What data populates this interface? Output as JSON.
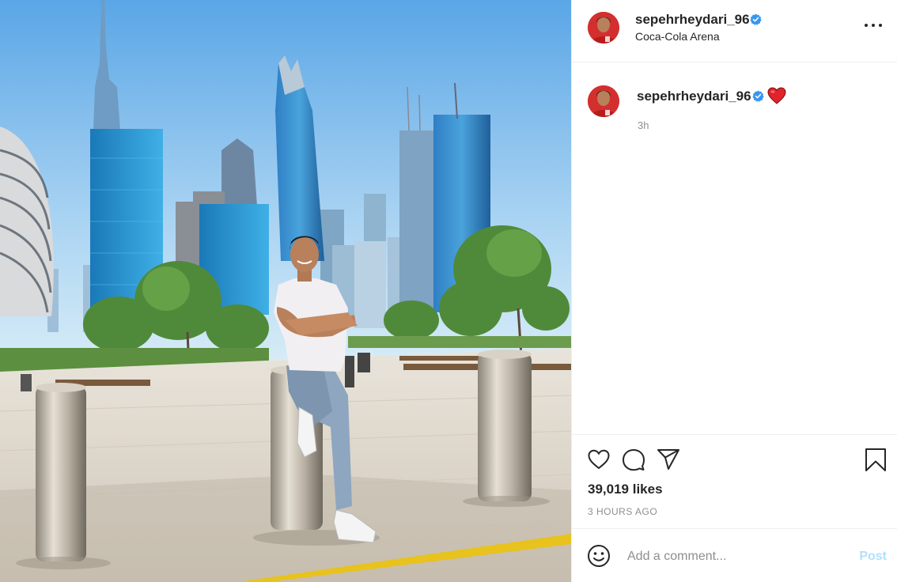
{
  "post": {
    "image_alt": "Man leaning on a bollard in front of Dubai skyscrapers",
    "colors": {
      "accent": "#0095f6",
      "verified": "#3897f0",
      "heart": "#ed4956"
    }
  },
  "header": {
    "username": "sepehrheydari_96",
    "location": "Coca-Cola Arena",
    "verified_icon": "verified-badge-icon",
    "more_icon": "more-options-icon"
  },
  "caption": {
    "username": "sepehrheydari_96",
    "emoji": "❤️",
    "time": "3h"
  },
  "actions": {
    "like_icon": "heart-icon",
    "comment_icon": "comment-icon",
    "share_icon": "share-icon",
    "save_icon": "bookmark-icon"
  },
  "likes_text": "39,019 likes",
  "post_time": "3 HOURS AGO",
  "add_comment": {
    "placeholder": "Add a comment...",
    "post_label": "Post",
    "emoji_icon": "smiley-icon"
  }
}
